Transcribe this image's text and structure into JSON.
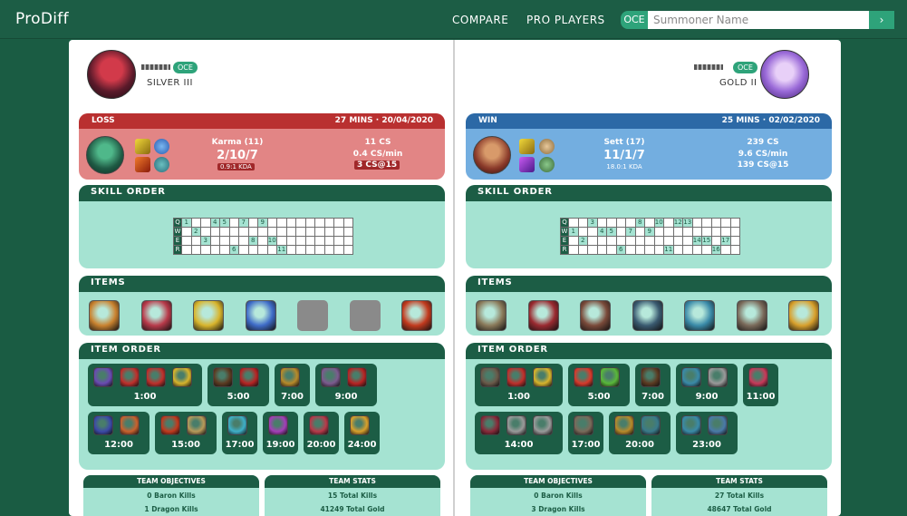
{
  "app": {
    "logo": "ProDiff"
  },
  "nav": {
    "compare": "COMPARE",
    "pro_players": "PRO PLAYERS"
  },
  "search": {
    "region": "OCE",
    "placeholder": "Summoner Name",
    "go": "›"
  },
  "left": {
    "region": "OCE",
    "rank": "SILVER III",
    "result": "LOSS",
    "meta": "27 MINS · 20/04/2020",
    "champion": "Karma (11)",
    "kda": "2/10/7",
    "kda_ratio": "0.9:1 KDA",
    "cs": "11 CS",
    "cs_min": "0.4 CS/min",
    "cs15": "3 CS@15",
    "skill_header": "SKILL ORDER",
    "items_header": "ITEMS",
    "item_order_header": "ITEM ORDER",
    "skills": {
      "Q": [
        1,
        4,
        5,
        7,
        9
      ],
      "W": [
        2
      ],
      "E": [
        3,
        8,
        10
      ],
      "R": [
        6,
        11
      ]
    },
    "items": [
      "#c9822f",
      "#b83a4a",
      "#d8b42c",
      "#3f6cc8",
      "empty",
      "empty",
      "#c23a1e"
    ],
    "item_groups": [
      {
        "time": "1:00",
        "icons": [
          "#6a4bb3",
          "#c0302c",
          "#c0302c",
          "#d8b42c"
        ]
      },
      {
        "time": "5:00",
        "icons": [
          "#5c3b22",
          "#b82424"
        ]
      },
      {
        "time": "7:00",
        "icons": [
          "#b88a2a"
        ]
      },
      {
        "time": "9:00",
        "icons": [
          "#7c5b8f",
          "#b82424"
        ]
      },
      {
        "time": "12:00",
        "icons": [
          "#3c49a8",
          "#c9622e"
        ]
      },
      {
        "time": "15:00",
        "icons": [
          "#c23a1e",
          "#b89a5a"
        ]
      },
      {
        "time": "17:00",
        "icons": [
          "#3fb0c8"
        ]
      },
      {
        "time": "19:00",
        "icons": [
          "#a43fb8"
        ]
      },
      {
        "time": "20:00",
        "icons": [
          "#b83a4a"
        ]
      },
      {
        "time": "24:00",
        "icons": [
          "#d8a02c"
        ]
      }
    ],
    "team_objectives_header": "TEAM OBJECTIVES",
    "team_objectives": [
      "0 Baron Kills",
      "1 Dragon Kills"
    ],
    "team_stats_header": "TEAM STATS",
    "team_stats": [
      "15 Total Kills",
      "41249 Total Gold"
    ]
  },
  "right": {
    "region": "OCE",
    "rank": "GOLD II",
    "result": "WIN",
    "meta": "25 MINS · 02/02/2020",
    "champion": "Sett (17)",
    "kda": "11/1/7",
    "kda_ratio": "18.0:1 KDA",
    "cs": "239 CS",
    "cs_min": "9.6 CS/min",
    "cs15": "139 CS@15",
    "skill_header": "SKILL ORDER",
    "items_header": "ITEMS",
    "item_order_header": "ITEM ORDER",
    "skills": {
      "Q": [
        3,
        8,
        10,
        12,
        13
      ],
      "W": [
        1,
        4,
        5,
        7,
        9
      ],
      "E": [
        2,
        14,
        15,
        17
      ],
      "R": [
        6,
        11,
        16
      ]
    },
    "items": [
      "#8a7a5a",
      "#9a2a30",
      "#7a4a3a",
      "#3a5a70",
      "#3a8aa8",
      "#7a6a5a",
      "#d8a02c"
    ],
    "item_groups": [
      {
        "time": "1:00",
        "icons": [
          "#6a5a4a",
          "#c0302c",
          "#d8b42c"
        ]
      },
      {
        "time": "5:00",
        "icons": [
          "#d83a2c",
          "#5ab83a"
        ]
      },
      {
        "time": "7:00",
        "icons": [
          "#5c3b22"
        ]
      },
      {
        "time": "9:00",
        "icons": [
          "#3a8aa8",
          "#9a9a9a"
        ]
      },
      {
        "time": "11:00",
        "icons": [
          "#c83a5a"
        ]
      },
      {
        "time": "14:00",
        "icons": [
          "#8a2a3a",
          "#9a9a9a",
          "#9a9a9a"
        ]
      },
      {
        "time": "17:00",
        "icons": [
          "#7a6a5a"
        ]
      },
      {
        "time": "20:00",
        "icons": [
          "#b88a2a",
          "#3a7a8a"
        ]
      },
      {
        "time": "23:00",
        "icons": [
          "#3a8aa8",
          "#4a7aa8"
        ]
      }
    ],
    "team_objectives_header": "TEAM OBJECTIVES",
    "team_objectives": [
      "0 Baron Kills",
      "3 Dragon Kills"
    ],
    "team_stats_header": "TEAM STATS",
    "team_stats": [
      "27 Total Kills",
      "48647 Total Gold"
    ]
  },
  "colors": {
    "brand": "#1c5d45",
    "accent": "#2ea37a",
    "loss": "#e28585",
    "loss_head": "#b93030",
    "win": "#73aee0",
    "win_head": "#2c69a6",
    "panel": "#a5e3d2"
  }
}
